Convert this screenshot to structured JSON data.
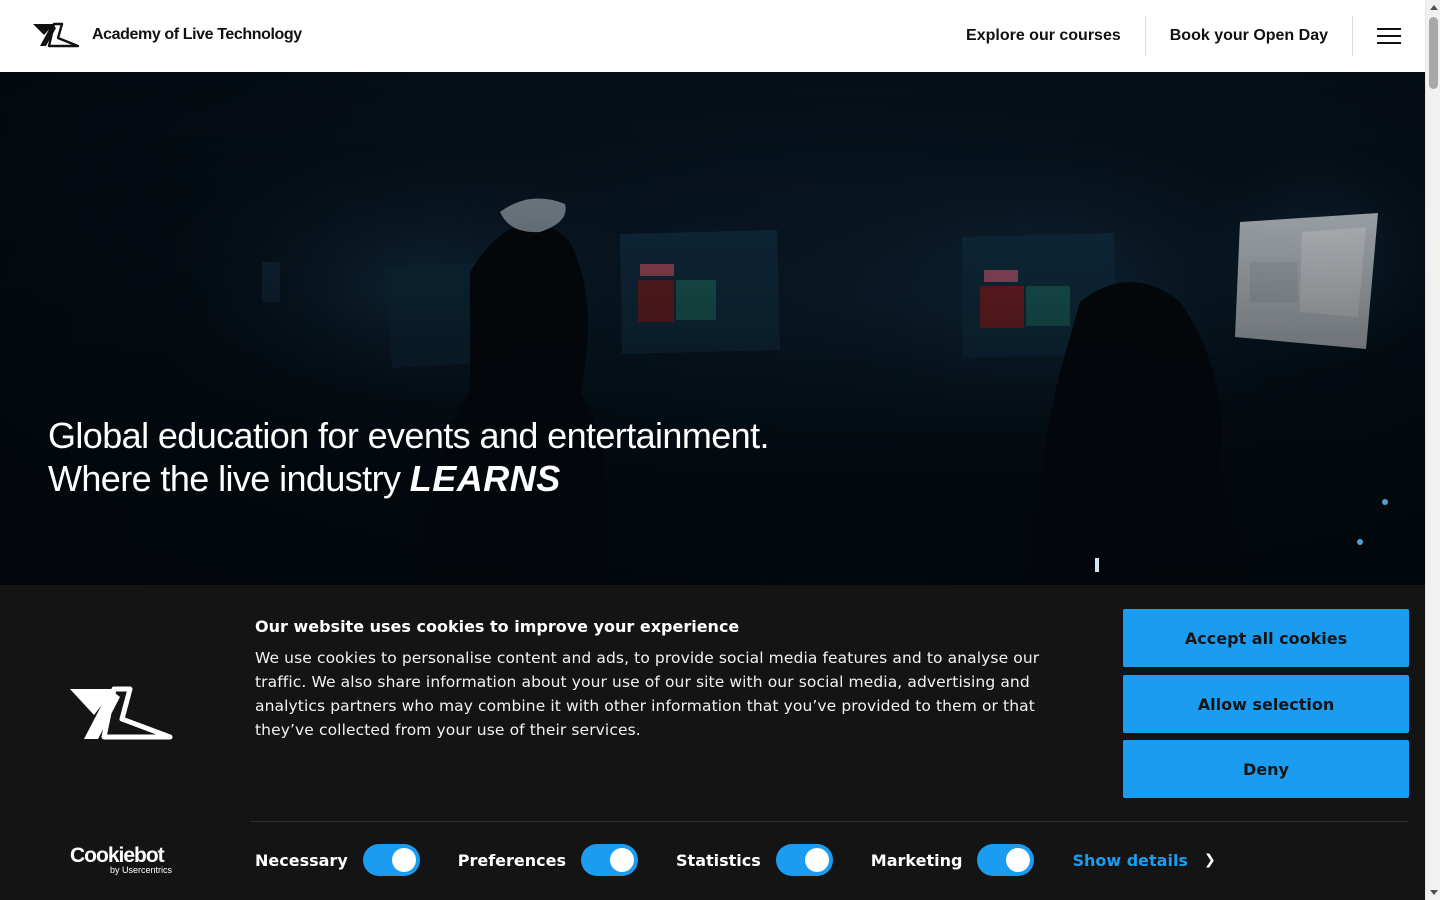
{
  "header": {
    "site_name": "Academy of Live Technology",
    "nav": {
      "explore": "Explore our courses",
      "book": "Book your Open Day"
    }
  },
  "hero": {
    "line1": "Global education for events and entertainment.",
    "line2": "Where the live industry",
    "emphasis": "LEARNS"
  },
  "cookie_banner": {
    "title": "Our website uses cookies to improve your experience",
    "body": "We use cookies to personalise content and ads, to provide social media features and to analyse our traffic. We also share information about your use of our site with our social media, advertising and analytics partners who may combine it with other information that you’ve provided to them or that they’ve collected from your use of their services.",
    "buttons": {
      "accept": "Accept all cookies",
      "allow": "Allow selection",
      "deny": "Deny"
    },
    "toggles": [
      {
        "label": "Necessary",
        "on": true
      },
      {
        "label": "Preferences",
        "on": true
      },
      {
        "label": "Statistics",
        "on": true
      },
      {
        "label": "Marketing",
        "on": true
      }
    ],
    "show_details": "Show details",
    "brand": {
      "name": "Cookiebot",
      "by": "by Usercentrics"
    }
  },
  "colors": {
    "accent": "#1a9cf0",
    "banner_bg": "#141414"
  }
}
